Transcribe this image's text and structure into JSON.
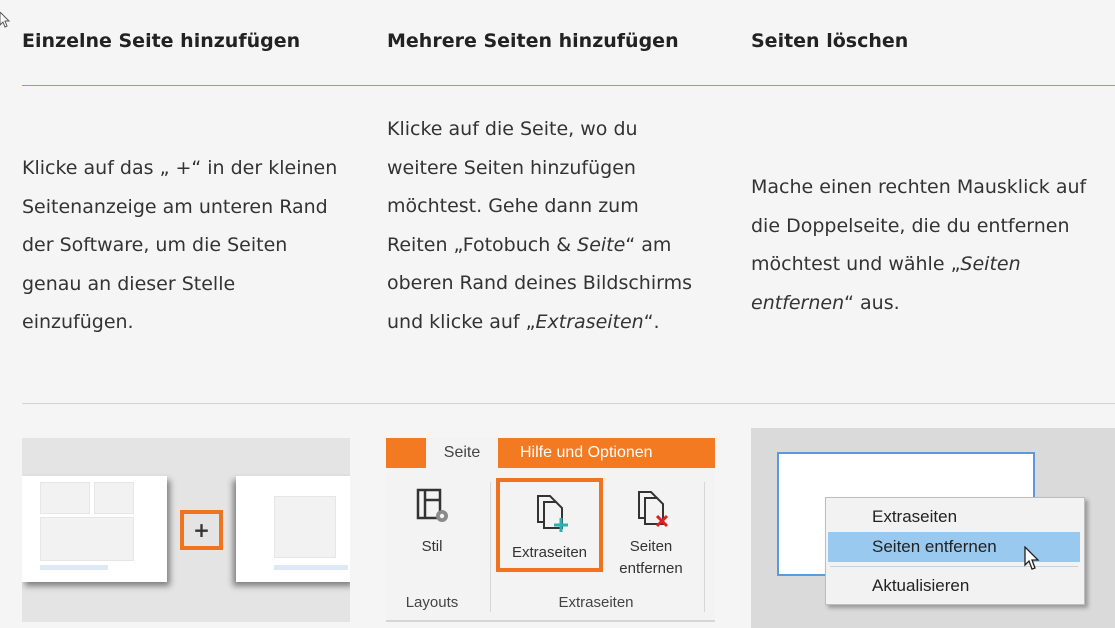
{
  "columns": [
    {
      "header": "Einzelne Seite hinzufügen",
      "text": [
        {
          "t": "Klicke auf das „ +“ in der kleinen Seitenanzeige am unteren Rand der Software, um die Seiten genau an dieser Stelle einzufügen.",
          "i": false
        }
      ]
    },
    {
      "header": "Mehrere Seiten hinzufügen",
      "text": [
        {
          "t": "Klicke auf die Seite, wo du weitere Seiten hinzufügen möchtest. Gehe dann zum Reiten „Fotobuch & ",
          "i": false
        },
        {
          "t": "Seite",
          "i": true
        },
        {
          "t": "“ am oberen Rand deines Bildschirms und klicke auf „",
          "i": false
        },
        {
          "t": "Extraseiten",
          "i": true
        },
        {
          "t": "“.",
          "i": false
        }
      ]
    },
    {
      "header": "Seiten löschen",
      "text": [
        {
          "t": "Mache einen rechten Mausklick auf die Doppelseite, die du entfernen möchtest und wähle „",
          "i": false
        },
        {
          "t": "Seiten entfernen",
          "i": true
        },
        {
          "t": "“ aus.",
          "i": false
        }
      ]
    }
  ],
  "image1": {
    "plus_label": "+"
  },
  "image2": {
    "tab_seite": "Seite",
    "tab_hilfe": "Hilfe und Optionen",
    "btn_stil": "Stil",
    "btn_extraseiten": "Extraseiten",
    "btn_entfernen_1": "Seiten",
    "btn_entfernen_2": "entfernen",
    "group_layouts": "Layouts",
    "group_extraseiten": "Extraseiten"
  },
  "image3": {
    "menu": [
      "Extraseiten",
      "Seiten entfernen",
      "Aktualisieren"
    ]
  },
  "colors": {
    "accent": "#f47a22",
    "rule": "#e98256",
    "highlight": "#99c9ef"
  }
}
